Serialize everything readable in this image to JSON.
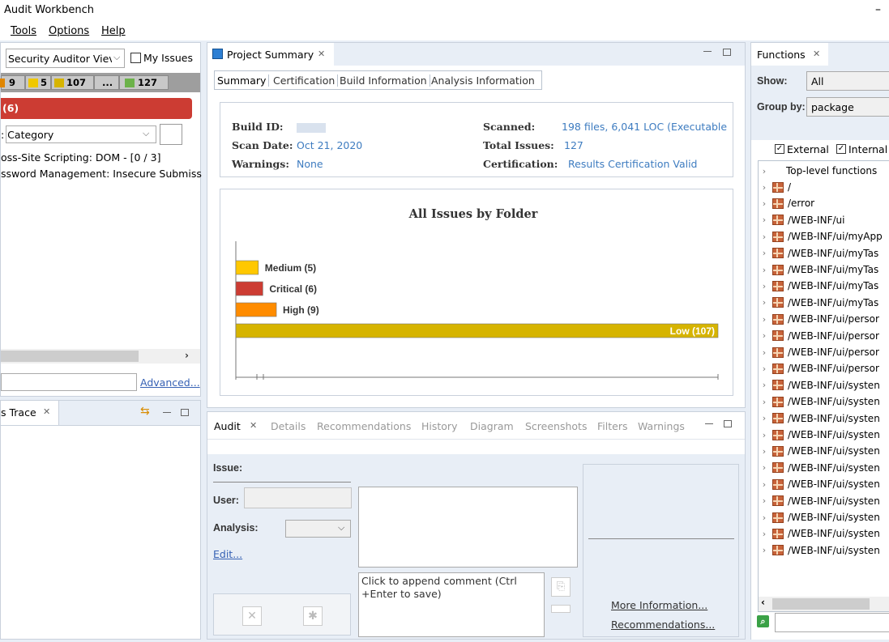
{
  "app": {
    "title": "Audit Workbench",
    "minimize": "–"
  },
  "menu": [
    "Tools",
    "Options",
    "Help"
  ],
  "left": {
    "perspective_select": "Security Auditor Viev",
    "my_issues_label": "My Issues",
    "counts": {
      "critical": "9",
      "high": "5",
      "medium": "107",
      "more": "...",
      "all": "127"
    },
    "critical_bar": "(6)",
    "group_by_label": ": Category",
    "issues": [
      "oss-Site Scripting: DOM - [0 / 3]",
      "ssword Management: Insecure Submiss"
    ],
    "advanced_link": "Advanced...",
    "trace_tab": "s Trace"
  },
  "summary": {
    "tab_title": "Project Summary",
    "subtabs": [
      "Summary",
      "Certification",
      "Build Information",
      "Analysis Information"
    ],
    "build_id_label": "Build ID:",
    "scan_date_label": "Scan Date:",
    "scan_date_value": "Oct 21, 2020",
    "warnings_label": "Warnings:",
    "warnings_value": "None",
    "scanned_label": "Scanned:",
    "scanned_value": "198 files, 6,041 LOC (Executable",
    "total_issues_label": "Total Issues:",
    "total_issues_value": "127",
    "cert_label": "Certification:",
    "cert_value": "Results Certification Valid"
  },
  "chart_data": {
    "type": "bar",
    "title": "All Issues by Folder",
    "orientation": "horizontal",
    "categories": [
      "Medium",
      "Critical",
      "High",
      "Low"
    ],
    "values": [
      5,
      6,
      9,
      107
    ],
    "labels": [
      "Medium (5)",
      "Critical (6)",
      "High (9)",
      "Low (107)"
    ],
    "colors": [
      "#ffc800",
      "#cc3c33",
      "#ff8c00",
      "#d6b400"
    ],
    "xlim": [
      0,
      107
    ],
    "grid": false,
    "legend": "none"
  },
  "audit": {
    "tabs": [
      "Audit",
      "Details",
      "Recommendations",
      "History",
      "Diagram",
      "Screenshots",
      "Filters",
      "Warnings"
    ],
    "issue_label": "Issue:",
    "user_label": "User:",
    "analysis_label": "Analysis:",
    "edit_link": "Edit...",
    "comment_placeholder": "Click to append comment (Ctrl +Enter to save)",
    "more_info_link": "More Information...",
    "recommendations_link": "Recommendations..."
  },
  "functions": {
    "tab_title": "Functions",
    "show_label": "Show:",
    "show_value": "All",
    "group_by_label": "Group by:",
    "group_by_value": "package",
    "external_label": "External",
    "internal_label": "Internal",
    "top_level": "Top-level functions",
    "items": [
      "/",
      "/error",
      "/WEB-INF/ui",
      "/WEB-INF/ui/myApp",
      "/WEB-INF/ui/myTas",
      "/WEB-INF/ui/myTas",
      "/WEB-INF/ui/myTas",
      "/WEB-INF/ui/myTas",
      "/WEB-INF/ui/persor",
      "/WEB-INF/ui/persor",
      "/WEB-INF/ui/persor",
      "/WEB-INF/ui/persor",
      "/WEB-INF/ui/systen",
      "/WEB-INF/ui/systen",
      "/WEB-INF/ui/systen",
      "/WEB-INF/ui/systen",
      "/WEB-INF/ui/systen",
      "/WEB-INF/ui/systen",
      "/WEB-INF/ui/systen",
      "/WEB-INF/ui/systen",
      "/WEB-INF/ui/systen",
      "/WEB-INF/ui/systen",
      "/WEB-INF/ui/systen"
    ]
  }
}
